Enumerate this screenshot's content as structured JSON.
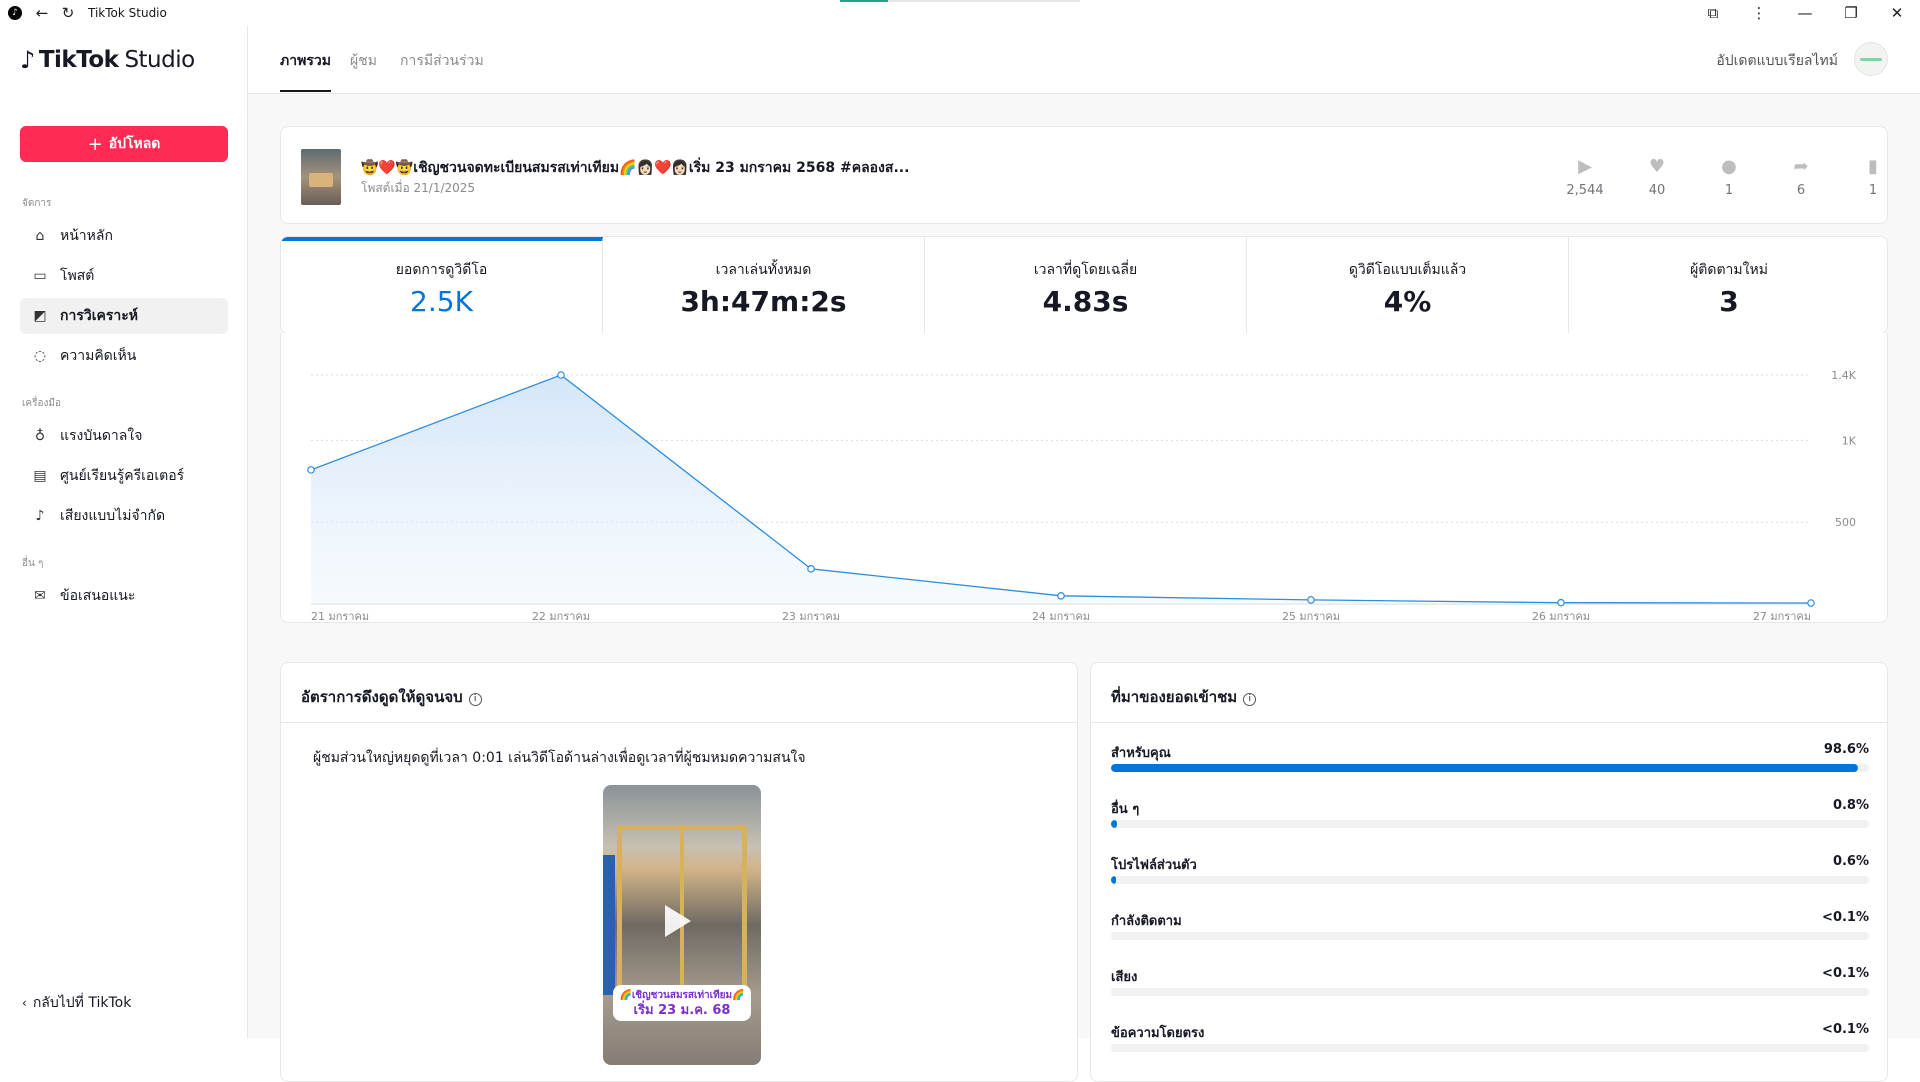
{
  "window": {
    "title": "TikTok Studio"
  },
  "brand": {
    "name": "TikTok",
    "suffix": "Studio"
  },
  "sidebar": {
    "upload_label": "อัปโหลด",
    "sections": {
      "manage": "จัดการ",
      "tools": "เครื่องมือ",
      "others": "อื่น ๆ"
    },
    "items": [
      {
        "label": "หน้าหลัก",
        "icon": "home-icon"
      },
      {
        "label": "โพสต์",
        "icon": "folder-icon"
      },
      {
        "label": "การวิเคราะห์",
        "icon": "analytics-icon",
        "active": true
      },
      {
        "label": "ความคิดเห็น",
        "icon": "comment-icon"
      },
      {
        "label": "แรงบันดาลใจ",
        "icon": "lightbulb-icon"
      },
      {
        "label": "ศูนย์เรียนรู้ครีเอเตอร์",
        "icon": "book-icon"
      },
      {
        "label": "เสียงแบบไม่จำกัด",
        "icon": "music-note-icon"
      },
      {
        "label": "ข้อเสนอแนะ",
        "icon": "mail-icon"
      }
    ],
    "back_label": "กลับไปที่ TikTok"
  },
  "topnav": {
    "tabs": [
      {
        "label": "ภาพรวม",
        "active": true
      },
      {
        "label": "ผู้ชม"
      },
      {
        "label": "การมีส่วนร่วม"
      }
    ],
    "realtime_label": "อัปเดตแบบเรียลไทม์"
  },
  "post": {
    "title": "🤠❤️🤠เชิญชวนจดทะเบียนสมรสเท่าเทียม🌈👩🏻❤️👩🏻เริ่ม 23 มกราคม 2568 #คลองส...",
    "date": "โพสต์เมื่อ 21/1/2025",
    "stats": {
      "plays": "2,544",
      "likes": "40",
      "comments": "1",
      "shares": "6",
      "saves": "1"
    }
  },
  "metrics": [
    {
      "label": "ยอดการดูวิดีโอ",
      "value": "2.5K"
    },
    {
      "label": "เวลาเล่นทั้งหมด",
      "value": "3h:47m:2s"
    },
    {
      "label": "เวลาที่ดูโดยเฉลี่ย",
      "value": "4.83s"
    },
    {
      "label": "ดูวิดีโอแบบเต็มแล้ว",
      "value": "4%"
    },
    {
      "label": "ผู้ติดตามใหม่",
      "value": "3"
    }
  ],
  "chart_data": {
    "type": "area",
    "x": [
      "21 มกราคม",
      "22 มกราคม",
      "23 มกราคม",
      "24 มกราคม",
      "25 มกราคม",
      "26 มกราคม",
      "27 มกราคม"
    ],
    "series": [
      {
        "values": [
          820,
          1400,
          215,
          50,
          25,
          8,
          6
        ]
      }
    ],
    "yticks": [
      {
        "value": 500,
        "label": "500"
      },
      {
        "value": 1000,
        "label": "1K"
      },
      {
        "value": 1400,
        "label": "1.4K"
      }
    ],
    "ylim": [
      0,
      1400
    ],
    "grid": true,
    "color": "#2e8ede"
  },
  "retention": {
    "title": "อัตราการดึงดูดให้ดูจนจบ",
    "text": "ผู้ชมส่วนใหญ่หยุดดูที่เวลา 0:01 เล่นวิดีโอด้านล่างเพื่อดูเวลาที่ผู้ชมหมดความสนใจ",
    "sticker_line1": "🌈เชิญชวนสมรสเท่าเทียม🌈",
    "sticker_line2": "เริ่ม 23 ม.ค. 68"
  },
  "sources": {
    "title": "ที่มาของยอดเข้าชม",
    "items": [
      {
        "name": "สำหรับคุณ",
        "value": "98.6%",
        "fraction": 0.986
      },
      {
        "name": "อื่น ๆ",
        "value": "0.8%",
        "fraction": 0.008
      },
      {
        "name": "โปรไฟล์ส่วนตัว",
        "value": "0.6%",
        "fraction": 0.006
      },
      {
        "name": "กำลังติดตาม",
        "value": "<0.1%",
        "fraction": 0.0
      },
      {
        "name": "เสียง",
        "value": "<0.1%",
        "fraction": 0.0
      },
      {
        "name": "ข้อความโดยตรง",
        "value": "<0.1%",
        "fraction": 0.0
      }
    ]
  }
}
